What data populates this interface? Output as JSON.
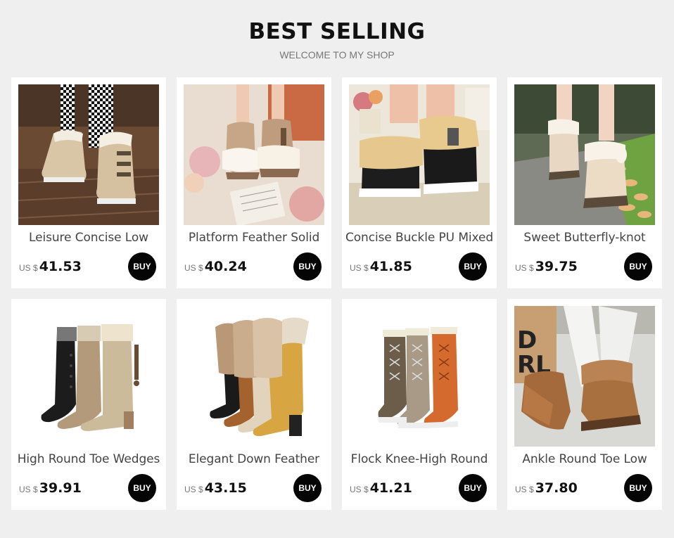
{
  "header": {
    "title": "BEST SELLING",
    "subtitle": "WELCOME TO MY SHOP"
  },
  "products": [
    {
      "name": "Leisure Concise Low",
      "currency": "US $",
      "price": "41.53",
      "buy_label": "BUY",
      "image": "beige-buckle-snow-boots"
    },
    {
      "name": "Platform Feather Solid",
      "currency": "US $",
      "price": "40.24",
      "buy_label": "BUY",
      "image": "tan-fur-ankle-boots"
    },
    {
      "name": "Concise Buckle PU Mixed",
      "currency": "US $",
      "price": "41.85",
      "buy_label": "BUY",
      "image": "black-fur-cuff-boots"
    },
    {
      "name": "Sweet Butterfly-knot",
      "currency": "US $",
      "price": "39.75",
      "buy_label": "BUY",
      "image": "beige-bow-ankle-boots"
    },
    {
      "name": "High Round Toe Wedges",
      "currency": "US $",
      "price": "39.91",
      "buy_label": "BUY",
      "image": "knee-high-wedge-boots"
    },
    {
      "name": "Elegant Down Feather",
      "currency": "US $",
      "price": "43.15",
      "buy_label": "BUY",
      "image": "lace-up-fur-knee-boots"
    },
    {
      "name": "Flock Knee-High Round",
      "currency": "US $",
      "price": "41.21",
      "buy_label": "BUY",
      "image": "lace-up-flock-knee-boots"
    },
    {
      "name": "Ankle Round Toe Low",
      "currency": "US $",
      "price": "37.80",
      "buy_label": "BUY",
      "image": "brown-fur-ankle-boots"
    }
  ],
  "colors": {
    "background": "#efefef",
    "card": "#ffffff",
    "buy_button": "#050505",
    "title": "#111111",
    "subtitle": "#777777"
  }
}
